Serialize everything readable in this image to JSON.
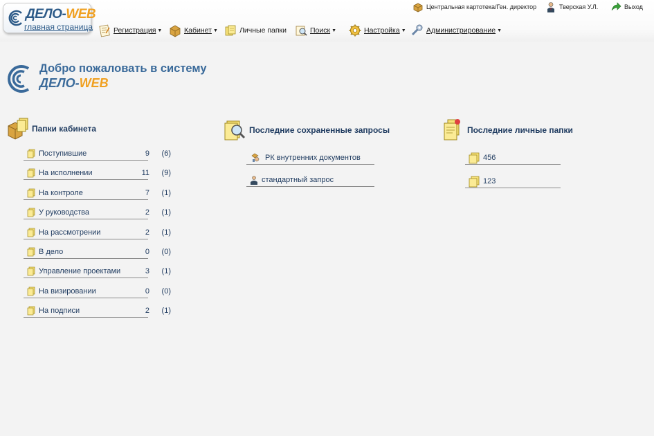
{
  "logo": {
    "brand_main": "ДЕЛО-",
    "brand_accent": "WEB",
    "subtitle": "главная страница"
  },
  "topbar": {
    "cabinet": "Центральная картотека/Ген. директор",
    "user": "Тверская У.Л.",
    "logout": "Выход"
  },
  "menu": {
    "items": [
      {
        "label": "Регистрация",
        "icon": "registration-icon"
      },
      {
        "label": "Кабинет",
        "icon": "cabinet-icon"
      },
      {
        "label": "Личные папки",
        "icon": "personal-folders-icon"
      },
      {
        "label": "Поиск",
        "icon": "search-icon"
      },
      {
        "label": "Настройка",
        "icon": "settings-icon"
      },
      {
        "label": "Администрирование",
        "icon": "admin-icon"
      }
    ]
  },
  "welcome": {
    "title": "Добро пожаловать в систему",
    "brand_main": "ДЕЛО-",
    "brand_accent": "WEB"
  },
  "cabinet_folders": {
    "title": "Папки кабинета",
    "items": [
      {
        "name": "Поступившие",
        "count": "9",
        "new": "(6)"
      },
      {
        "name": "На исполнении",
        "count": "11",
        "new": "(9)"
      },
      {
        "name": "На контроле",
        "count": "7",
        "new": "(1)"
      },
      {
        "name": "У руководства",
        "count": "2",
        "new": "(1)"
      },
      {
        "name": "На рассмотрении",
        "count": "2",
        "new": "(1)"
      },
      {
        "name": "В дело",
        "count": "0",
        "new": "(0)"
      },
      {
        "name": "Управление проектами",
        "count": "3",
        "new": "(1)"
      },
      {
        "name": "На визировании",
        "count": "0",
        "new": "(0)"
      },
      {
        "name": "На подписи",
        "count": "2",
        "new": "(1)"
      }
    ]
  },
  "saved_queries": {
    "title": "Последние сохраненные запросы",
    "items": [
      {
        "name": "РК внутренних документов"
      },
      {
        "name": "стандартный запрос"
      }
    ]
  },
  "personal_folders": {
    "title": "Последние личные папки",
    "items": [
      {
        "name": "456"
      },
      {
        "name": "123"
      }
    ]
  },
  "colors": {
    "accent_orange": "#f0a020",
    "brand_blue": "#2c5a88",
    "text_navy": "#1e3a5f",
    "background": "#f3f3f3"
  }
}
